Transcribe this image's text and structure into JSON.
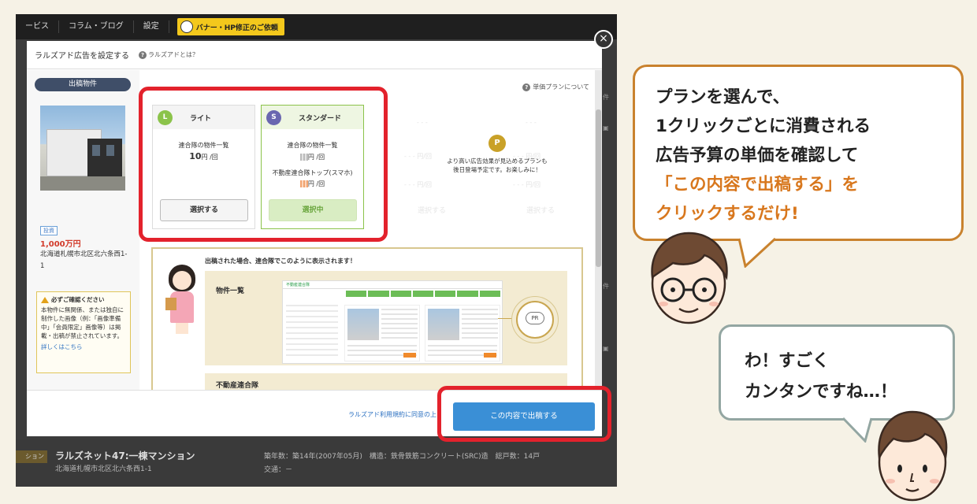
{
  "top_nav": {
    "items": [
      "ービス",
      "コラム・ブログ",
      "設定"
    ],
    "banner_button": "バナー・HP修正のご依頼"
  },
  "modal": {
    "title": "ラルズアド広告を設定する",
    "help_link": "ラルズアドとは？",
    "close_symbol": "×",
    "sidebar": {
      "section_label": "出稿物件",
      "tag": "投資",
      "price": "1,000万円",
      "address": "北海道札幌市北区北六条西1-1",
      "notice": {
        "title": "必ずご確認ください",
        "body": "本物件に無関係、または独自に制作した画像（例：「画像準備中」「会員限定」画像等）は掲載・出稿が禁止されています。",
        "link": "詳しくはこちら"
      }
    },
    "unit_price_help": "単価プランについて",
    "plans": [
      {
        "badge": "L",
        "badge_color": "#8bc34a",
        "name": "ライト",
        "line1": "連合隊の物件一覧",
        "price": "10",
        "unit": "円 /回",
        "button": "選択する"
      },
      {
        "badge": "S",
        "badge_color": "#6a67b0",
        "name": "スタンダード",
        "line1": "連合隊の物件一覧",
        "unit1": "円 /回",
        "line2": "不動産連合隊トップ(スマホ)",
        "unit2": "円 /回",
        "button": "選択中"
      }
    ],
    "coming_soon": {
      "icon": "P",
      "line1": "より高い広告効果が見込めるプランも",
      "line2": "後日登場予定です。お楽しみに！",
      "placeholders": [
        "- - -",
        "- - - 円/回",
        "- - - 円/回"
      ],
      "ghost_buttons": [
        "選択する",
        "選択する"
      ]
    },
    "preview": {
      "caption": "出稿された場合、連合隊でこのように表示されます！",
      "row1_label": "物件一覧",
      "row2_label": "不動産連合隊",
      "mock_site": "不動産連合隊",
      "pr_label": "PR"
    },
    "footer": {
      "terms": "ラルズアド利用規約に同意の上",
      "submit": "この内容で出稿する"
    }
  },
  "background_listing": {
    "tag": "ション",
    "title": "ラルズネット47:一棟マンション",
    "address": "北海道札幌市北区北六条西1-1",
    "meta": "築年数：築14年(2007年05月)　構造：鉄骨鉄筋コンクリート(SRC)造　総戸数：14戸",
    "traffic": "交通：－"
  },
  "callout_main": {
    "line1": "プランを選んで、",
    "line2": "1クリックごとに消費される",
    "line3": "広告予算の単価を確認して",
    "line4": "「この内容で出稿する」を",
    "line5": "クリックするだけ!"
  },
  "callout_reply": {
    "line1": "わ！すごく",
    "line2": "カンタンですね…！"
  },
  "colors": {
    "highlight": "#e3222c",
    "accent_text": "#d8771d",
    "submit_button": "#3a8fd6"
  }
}
